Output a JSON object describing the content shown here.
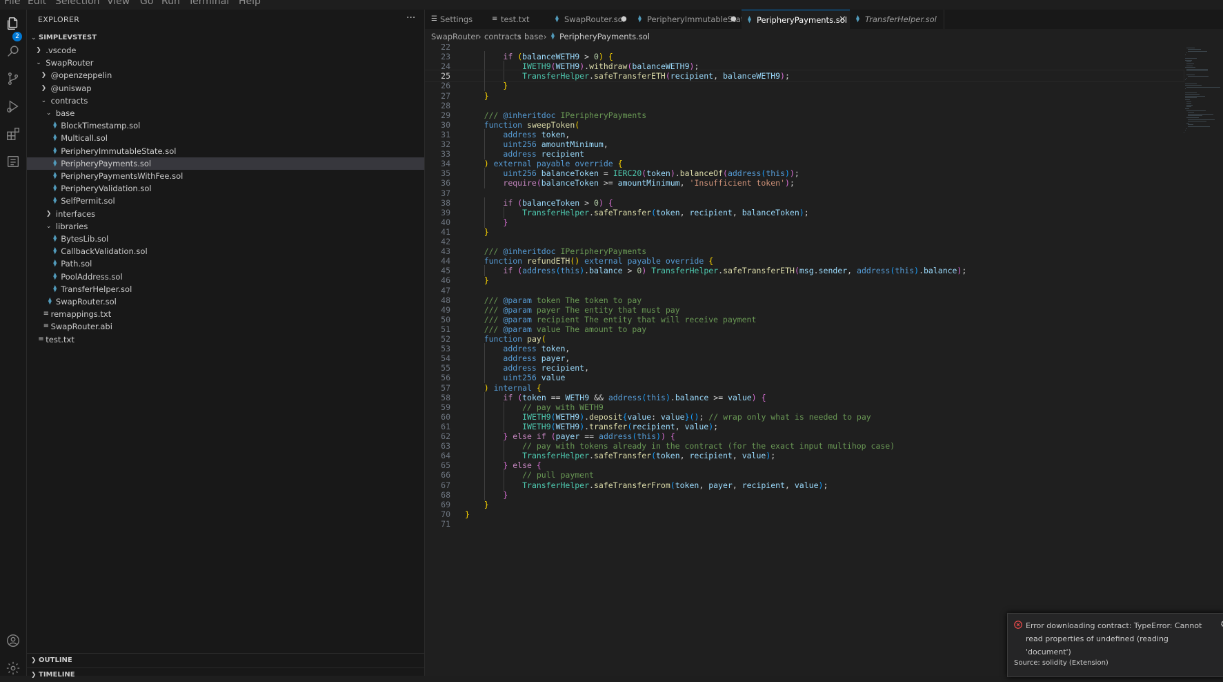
{
  "menu": [
    "File",
    "Edit",
    "Selection",
    "View",
    "Go",
    "Run",
    "Terminal",
    "Help"
  ],
  "activity_bar": {
    "explorer_badge": "2",
    "icons": [
      "files-icon",
      "search-icon",
      "source-control-icon",
      "run-debug-icon",
      "extensions-icon",
      "test-icon"
    ],
    "bottom_icons": [
      "account-icon",
      "settings-gear-icon"
    ]
  },
  "sidebar": {
    "title": "EXPLORER",
    "more": "···",
    "root": "SIMPLEVSTEST",
    "tree": [
      {
        "label": ".vscode",
        "kind": "folder",
        "expanded": false
      },
      {
        "label": "SwapRouter",
        "kind": "folder",
        "expanded": true
      },
      {
        "label": "@openzeppelin",
        "kind": "folder",
        "expanded": false
      },
      {
        "label": "@uniswap",
        "kind": "folder",
        "expanded": false
      },
      {
        "label": "contracts",
        "kind": "folder",
        "expanded": true
      },
      {
        "label": "base",
        "kind": "folder",
        "expanded": true
      },
      {
        "label": "BlockTimestamp.sol",
        "kind": "sol"
      },
      {
        "label": "Multicall.sol",
        "kind": "sol"
      },
      {
        "label": "PeripheryImmutableState.sol",
        "kind": "sol"
      },
      {
        "label": "PeripheryPayments.sol",
        "kind": "sol",
        "selected": true
      },
      {
        "label": "PeripheryPaymentsWithFee.sol",
        "kind": "sol"
      },
      {
        "label": "PeripheryValidation.sol",
        "kind": "sol"
      },
      {
        "label": "SelfPermit.sol",
        "kind": "sol"
      },
      {
        "label": "interfaces",
        "kind": "folder",
        "expanded": false
      },
      {
        "label": "libraries",
        "kind": "folder",
        "expanded": true
      },
      {
        "label": "BytesLib.sol",
        "kind": "sol"
      },
      {
        "label": "CallbackValidation.sol",
        "kind": "sol"
      },
      {
        "label": "Path.sol",
        "kind": "sol"
      },
      {
        "label": "PoolAddress.sol",
        "kind": "sol"
      },
      {
        "label": "TransferHelper.sol",
        "kind": "sol"
      },
      {
        "label": "SwapRouter.sol",
        "kind": "sol"
      },
      {
        "label": "remappings.txt",
        "kind": "txt"
      },
      {
        "label": "SwapRouter.abi",
        "kind": "txt"
      },
      {
        "label": "test.txt",
        "kind": "txt"
      }
    ],
    "outline_label": "OUTLINE",
    "timeline_label": "TIMELINE"
  },
  "tabs": [
    {
      "label": "Settings",
      "icon": "settings-file-icon"
    },
    {
      "label": "test.txt",
      "icon": "text-file-icon"
    },
    {
      "label": "SwapRouter.sol",
      "icon": "solidity-file-icon",
      "dirty": true
    },
    {
      "label": "PeripheryImmutableState.sol",
      "icon": "solidity-file-icon",
      "dirty": true
    },
    {
      "label": "PeripheryPayments.sol",
      "icon": "solidity-file-icon",
      "active": true,
      "close": "✕"
    },
    {
      "label": "TransferHelper.sol",
      "icon": "solidity-file-icon",
      "preview": true
    }
  ],
  "breadcrumb": [
    "SwapRouter",
    "contracts",
    "base",
    "PeripheryPayments.sol"
  ],
  "editor": {
    "current_line": 25,
    "lines": [
      {
        "n": "22",
        "t": ""
      },
      {
        "n": "23",
        "t": "        if (balanceWETH9 > 0) {"
      },
      {
        "n": "24",
        "t": "            IWETH9(WETH9).withdraw(balanceWETH9);"
      },
      {
        "n": "25",
        "t": "            TransferHelper.safeTransferETH(recipient, balanceWETH9);"
      },
      {
        "n": "26",
        "t": "        }"
      },
      {
        "n": "27",
        "t": "    }"
      },
      {
        "n": "28",
        "t": ""
      },
      {
        "n": "29",
        "t": "    /// @inheritdoc IPeripheryPayments"
      },
      {
        "n": "30",
        "t": "    function sweepToken("
      },
      {
        "n": "31",
        "t": "        address token,"
      },
      {
        "n": "32",
        "t": "        uint256 amountMinimum,"
      },
      {
        "n": "33",
        "t": "        address recipient"
      },
      {
        "n": "34",
        "t": "    ) external payable override {"
      },
      {
        "n": "35",
        "t": "        uint256 balanceToken = IERC20(token).balanceOf(address(this));"
      },
      {
        "n": "36",
        "t": "        require(balanceToken >= amountMinimum, 'Insufficient token');"
      },
      {
        "n": "37",
        "t": ""
      },
      {
        "n": "38",
        "t": "        if (balanceToken > 0) {"
      },
      {
        "n": "39",
        "t": "            TransferHelper.safeTransfer(token, recipient, balanceToken);"
      },
      {
        "n": "40",
        "t": "        }"
      },
      {
        "n": "41",
        "t": "    }"
      },
      {
        "n": "42",
        "t": ""
      },
      {
        "n": "43",
        "t": "    /// @inheritdoc IPeripheryPayments"
      },
      {
        "n": "44",
        "t": "    function refundETH() external payable override {"
      },
      {
        "n": "45",
        "t": "        if (address(this).balance > 0) TransferHelper.safeTransferETH(msg.sender, address(this).balance);"
      },
      {
        "n": "46",
        "t": "    }"
      },
      {
        "n": "47",
        "t": ""
      },
      {
        "n": "48",
        "t": "    /// @param token The token to pay"
      },
      {
        "n": "49",
        "t": "    /// @param payer The entity that must pay"
      },
      {
        "n": "50",
        "t": "    /// @param recipient The entity that will receive payment"
      },
      {
        "n": "51",
        "t": "    /// @param value The amount to pay"
      },
      {
        "n": "52",
        "t": "    function pay("
      },
      {
        "n": "53",
        "t": "        address token,"
      },
      {
        "n": "54",
        "t": "        address payer,"
      },
      {
        "n": "55",
        "t": "        address recipient,"
      },
      {
        "n": "56",
        "t": "        uint256 value"
      },
      {
        "n": "57",
        "t": "    ) internal {"
      },
      {
        "n": "58",
        "t": "        if (token == WETH9 && address(this).balance >= value) {"
      },
      {
        "n": "59",
        "t": "            // pay with WETH9"
      },
      {
        "n": "60",
        "t": "            IWETH9(WETH9).deposit{value: value}(); // wrap only what is needed to pay"
      },
      {
        "n": "61",
        "t": "            IWETH9(WETH9).transfer(recipient, value);"
      },
      {
        "n": "62",
        "t": "        } else if (payer == address(this)) {"
      },
      {
        "n": "63",
        "t": "            // pay with tokens already in the contract (for the exact input multihop case)"
      },
      {
        "n": "64",
        "t": "            TransferHelper.safeTransfer(token, recipient, value);"
      },
      {
        "n": "65",
        "t": "        } else {"
      },
      {
        "n": "66",
        "t": "            // pull payment"
      },
      {
        "n": "67",
        "t": "            TransferHelper.safeTransferFrom(token, payer, recipient, value);"
      },
      {
        "n": "68",
        "t": "        }"
      },
      {
        "n": "69",
        "t": "    }"
      },
      {
        "n": "70",
        "t": "}"
      },
      {
        "n": "71",
        "t": ""
      }
    ]
  },
  "notification": {
    "message": "Error downloading contract: TypeError: Cannot read properties of undefined (reading 'document')",
    "source": "Source: solidity (Extension)",
    "icon": "error-icon"
  },
  "colors": {
    "keyword": "#569cd6",
    "control": "#c586c0",
    "type": "#4ec9b0",
    "function": "#dcdcaa",
    "variable": "#9cdcfe",
    "string": "#ce9178",
    "number": "#b5cea8",
    "comment": "#6a9955",
    "bracket1": "#ffd700",
    "bracket2": "#da70d6",
    "bracket3": "#179fff",
    "accent": "#0078d4",
    "error": "#f14c4c"
  }
}
